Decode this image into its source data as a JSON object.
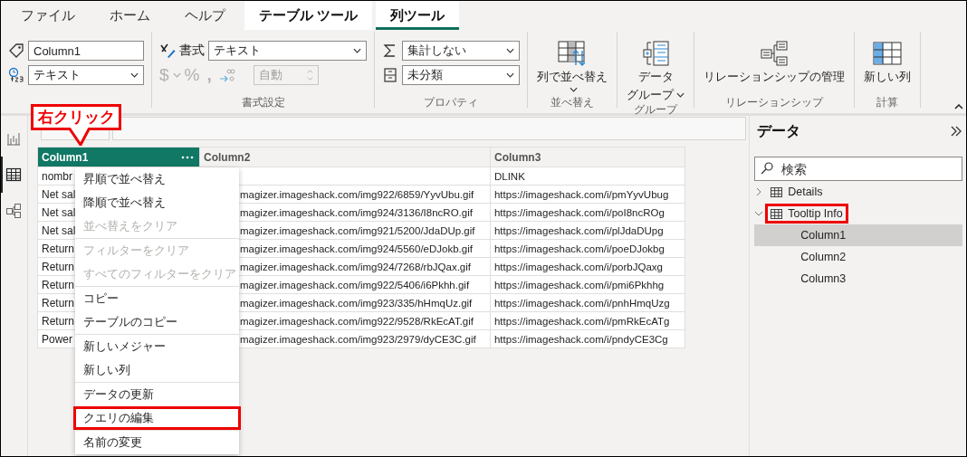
{
  "tabs": [
    {
      "label": "ファイル",
      "contextual": false,
      "selected": false
    },
    {
      "label": "ホーム",
      "contextual": false,
      "selected": false
    },
    {
      "label": "ヘルプ",
      "contextual": false,
      "selected": false
    },
    {
      "label": "テーブル ツール",
      "contextual": true,
      "selected": false
    },
    {
      "label": "列ツール",
      "contextual": true,
      "selected": true
    }
  ],
  "ribbon": {
    "groups": [
      {
        "kind": "structure",
        "name_value": "Column1",
        "type_value": "テキスト"
      },
      {
        "kind": "formatting",
        "label": "書式設定",
        "format_label": "書式",
        "format_value": "テキスト",
        "currency": "$",
        "percent": "%",
        "comma": ",",
        "number_disabled": true,
        "decimal_value": "自動"
      },
      {
        "kind": "properties",
        "label": "プロパティ",
        "summarization": "集計しない",
        "category": "未分類"
      },
      {
        "kind": "sort",
        "label": "並べ替え",
        "lines": [
          "列で並べ替え"
        ],
        "dropdown": true
      },
      {
        "kind": "group",
        "label": "グループ",
        "lines": [
          "データ",
          "グループ"
        ],
        "dropdown": true
      },
      {
        "kind": "relationship",
        "label": "リレーションシップ",
        "lines": [
          "リレーションシップの管理"
        ],
        "dropdown": false
      },
      {
        "kind": "new-column",
        "label": "計算",
        "lines": [
          "新しい列"
        ],
        "dropdown": false
      }
    ]
  },
  "nav": [
    {
      "kind": "report",
      "selected": false
    },
    {
      "kind": "table",
      "selected": true
    },
    {
      "kind": "model",
      "selected": false
    }
  ],
  "callout": {
    "text": "右クリック"
  },
  "table": {
    "columns": [
      {
        "title": "Column1",
        "selected": true
      },
      {
        "title": "Column2",
        "selected": false
      },
      {
        "title": "Column3",
        "selected": false
      }
    ],
    "rows": [
      [
        "nombr",
        null,
        "DLINK"
      ],
      [
        "Net sal",
        "magizer.imageshack.com/img922/6859/YyvUbu.gif",
        "https://imageshack.com/i/pmYyvUbug"
      ],
      [
        "Net sal",
        "magizer.imageshack.com/img924/3136/I8ncRO.gif",
        "https://imageshack.com/i/poI8ncROg"
      ],
      [
        "Net sal",
        "magizer.imageshack.com/img921/5200/JdaDUp.gif",
        "https://imageshack.com/i/plJdaDUpg"
      ],
      [
        "Return",
        "magizer.imageshack.com/img924/5560/eDJokb.gif",
        "https://imageshack.com/i/poeDJokbg"
      ],
      [
        "Return",
        "magizer.imageshack.com/img924/7268/rbJQax.gif",
        "https://imageshack.com/i/porbJQaxg"
      ],
      [
        "Return",
        "magizer.imageshack.com/img922/5406/i6Pkhh.gif",
        "https://imageshack.com/i/pmi6Pkhhg"
      ],
      [
        "Return",
        "magizer.imageshack.com/img923/335/hHmqUz.gif",
        "https://imageshack.com/i/pnhHmqUzg"
      ],
      [
        "Return",
        "magizer.imageshack.com/img922/9528/RkEcAT.gif",
        "https://imageshack.com/i/pmRkEcATg"
      ],
      [
        "Power",
        "magizer.imageshack.com/img923/2979/dyCE3C.gif",
        "https://imageshack.com/i/pndyCE3Cg"
      ]
    ]
  },
  "menu": {
    "sections": [
      {
        "items": [
          {
            "label": "昇順で並べ替え",
            "disabled": false,
            "annotated": false
          },
          {
            "label": "降順で並べ替え",
            "disabled": false,
            "annotated": false
          },
          {
            "label": "並べ替えをクリア",
            "disabled": true,
            "annotated": false
          }
        ]
      },
      {
        "items": [
          {
            "label": "フィルターをクリア",
            "disabled": true,
            "annotated": false
          },
          {
            "label": "すべてのフィルターをクリア",
            "disabled": true,
            "annotated": false
          }
        ]
      },
      {
        "items": [
          {
            "label": "コピー",
            "disabled": false,
            "annotated": false
          },
          {
            "label": "テーブルのコピー",
            "disabled": false,
            "annotated": false
          }
        ]
      },
      {
        "items": [
          {
            "label": "新しいメジャー",
            "disabled": false,
            "annotated": false
          },
          {
            "label": "新しい列",
            "disabled": false,
            "annotated": false
          }
        ]
      },
      {
        "items": [
          {
            "label": "データの更新",
            "disabled": false,
            "annotated": false
          },
          {
            "label": "クエリの編集",
            "disabled": false,
            "annotated": true
          }
        ]
      },
      {
        "items": [
          {
            "label": "名前の変更",
            "disabled": false,
            "annotated": false
          }
        ]
      }
    ]
  },
  "data_pane": {
    "title": "データ",
    "search": {
      "placeholder": "検索"
    },
    "tree": [
      {
        "label": "Details",
        "expanded": false,
        "annotated": false
      },
      {
        "label": "Tooltip Info",
        "expanded": true,
        "annotated": true,
        "children": [
          {
            "label": "Column1",
            "selected": true
          },
          {
            "label": "Column2",
            "selected": false
          },
          {
            "label": "Column3",
            "selected": false
          }
        ]
      }
    ]
  }
}
